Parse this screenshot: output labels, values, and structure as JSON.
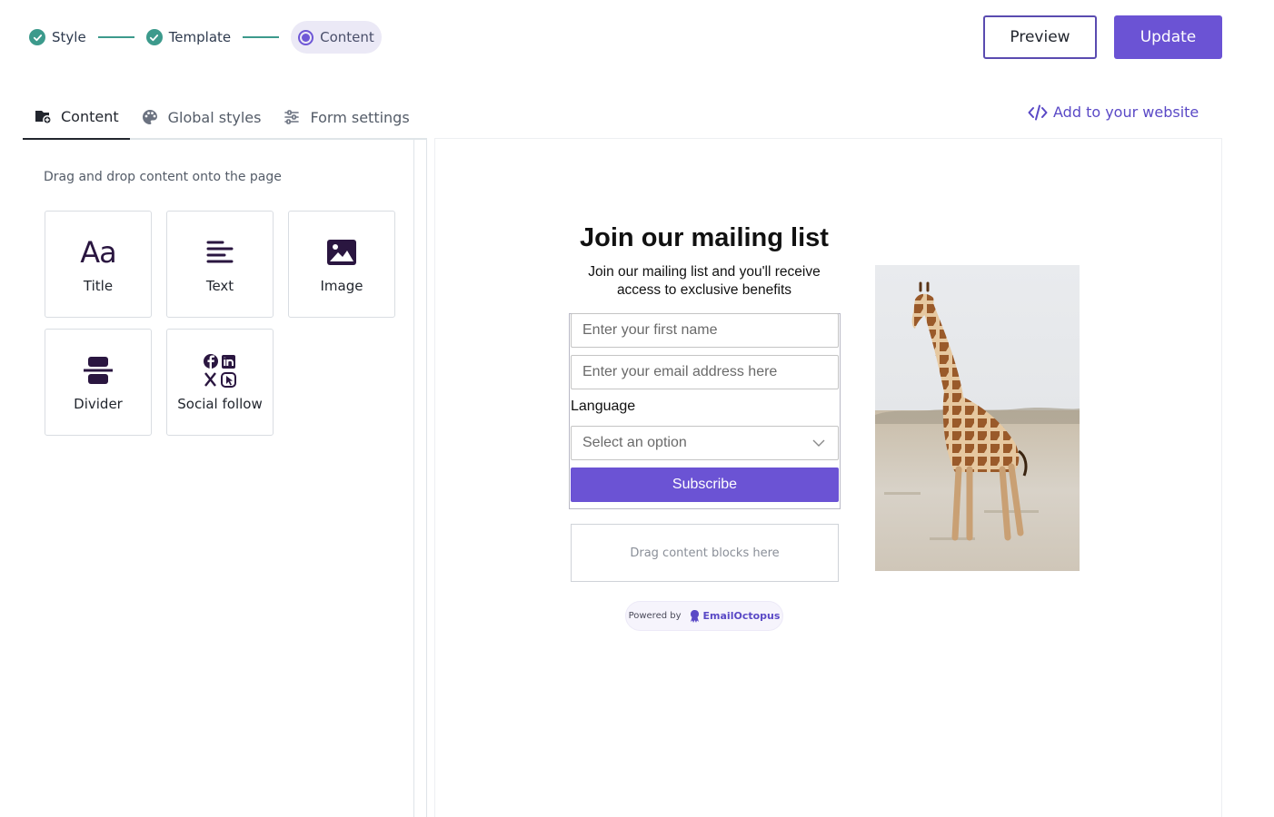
{
  "stepper": {
    "steps": [
      {
        "label": "Style",
        "state": "done"
      },
      {
        "label": "Template",
        "state": "done"
      },
      {
        "label": "Content",
        "state": "current"
      }
    ]
  },
  "header": {
    "preview_label": "Preview",
    "update_label": "Update"
  },
  "tabs": [
    {
      "label": "Content",
      "icon": "content-block-icon",
      "active": true
    },
    {
      "label": "Global styles",
      "icon": "palette-icon",
      "active": false
    },
    {
      "label": "Form settings",
      "icon": "sliders-icon",
      "active": false
    }
  ],
  "add_to_website": {
    "label": "Add to your website",
    "icon": "code-icon"
  },
  "panel": {
    "hint": "Drag and drop content onto the page",
    "blocks": [
      {
        "label": "Title",
        "icon": "title-aa-icon"
      },
      {
        "label": "Text",
        "icon": "text-lines-icon"
      },
      {
        "label": "Image",
        "icon": "image-icon"
      },
      {
        "label": "Divider",
        "icon": "divider-icon"
      },
      {
        "label": "Social follow",
        "icon": "social-icons"
      }
    ]
  },
  "form": {
    "title": "Join our mailing list",
    "subtitle": "Join our mailing list and you'll receive access to exclusive benefits",
    "first_name_placeholder": "Enter your first name",
    "email_placeholder": "Enter your email address here",
    "language_label": "Language",
    "language_select": "Select an option",
    "subscribe_label": "Subscribe",
    "drop_zone": "Drag content blocks here",
    "powered_by": "Powered by",
    "brand": "EmailOctopus"
  },
  "colors": {
    "accent": "#6b53d4",
    "step_done": "#3c9a8c",
    "link": "#5a49c6"
  }
}
